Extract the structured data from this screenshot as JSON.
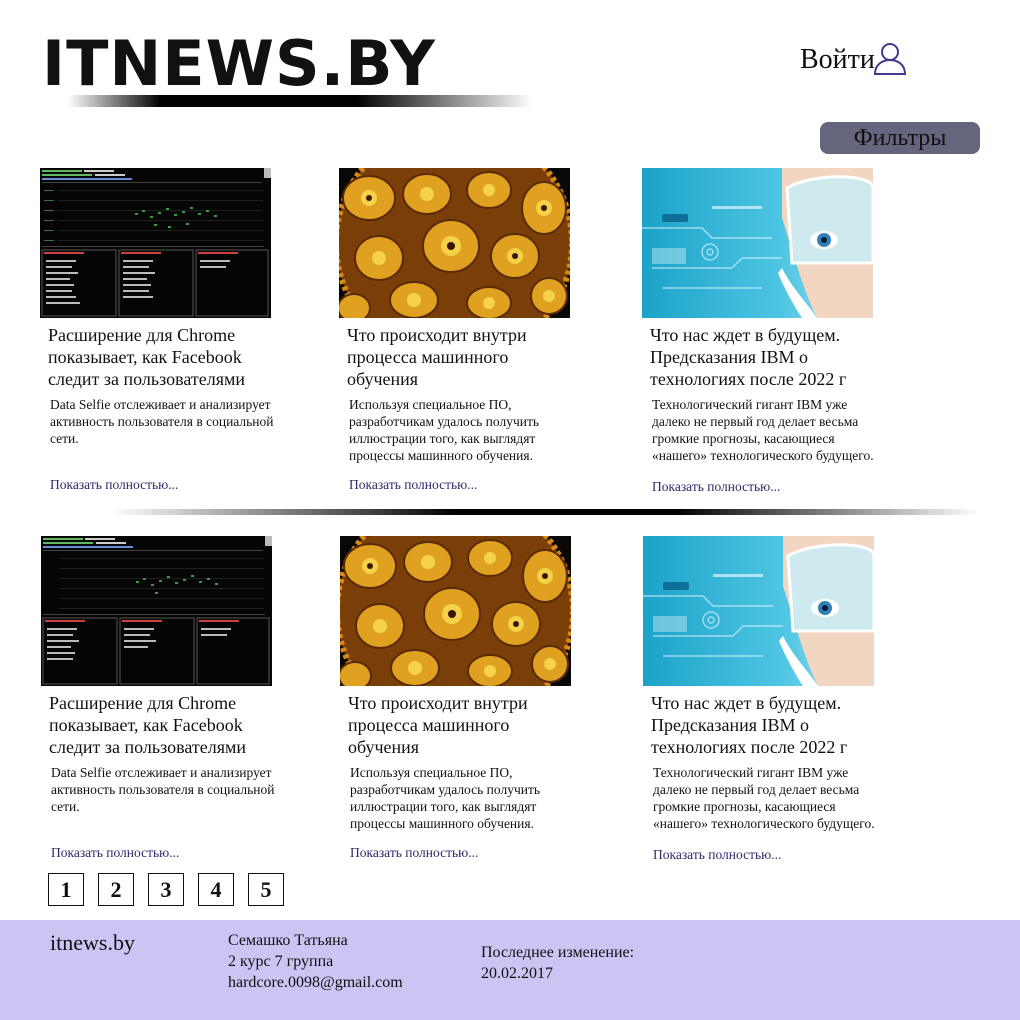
{
  "header": {
    "logo": "ITNEWS.BY",
    "login_label": "Войти",
    "filters_label": "Фильтры"
  },
  "articles": [
    {
      "title": "Расширение для Chrome показывает, как Facebook следит за пользователями",
      "desc": "Data Selfie отслеживает и анализирует активность пользователя в социальной сети.",
      "more": "Показать полностью..."
    },
    {
      "title": "Что происходит внутри процесса машинного обучения",
      "desc": "Используя специальное ПО, разработчикам удалось получить иллюстрации того, как выглядят процессы машинного обучения.",
      "more": "Показать полностью..."
    },
    {
      "title": "Что нас ждет в будущем. Предсказания IBM о технологиях после 2022 г",
      "desc": "Технологический гигант IBM уже далеко не первый год делает весьма громкие прогнозы, касающиеся «нашего» технологического будущего.",
      "more": "Показать полностью..."
    },
    {
      "title": "Расширение для Chrome показывает, как Facebook следит за пользователями",
      "desc": "Data Selfie отслеживает и анализирует активность пользователя в социальной сети.",
      "more": "Показать полностью..."
    },
    {
      "title": "Что происходит внутри процесса машинного обучения",
      "desc": "Используя специальное ПО, разработчикам удалось получить иллюстрации того, как выглядят процессы машинного обучения.",
      "more": "Показать полностью..."
    },
    {
      "title": "Что нас ждет в будущем. Предсказания IBM о технологиях после 2022 г",
      "desc": "Технологический гигант IBM уже далеко не первый год делает весьма громкие прогнозы, касающиеся «нашего» технологического будущего.",
      "more": "Показать полностью..."
    }
  ],
  "pagination": [
    "1",
    "2",
    "3",
    "4",
    "5"
  ],
  "footer": {
    "site": "itnews.by",
    "author_name": "Семашко Татьяна",
    "author_group": "2 курс 7 группа",
    "author_email": "hardcore.0098@gmail.com",
    "updated_label": "Последнее изменение:",
    "updated_date": "20.02.2017"
  },
  "colors": {
    "filters_bg": "#65667e",
    "footer_bg": "#cac5f3",
    "link": "#2c2a6a",
    "user_icon": "#3f3a8c"
  }
}
